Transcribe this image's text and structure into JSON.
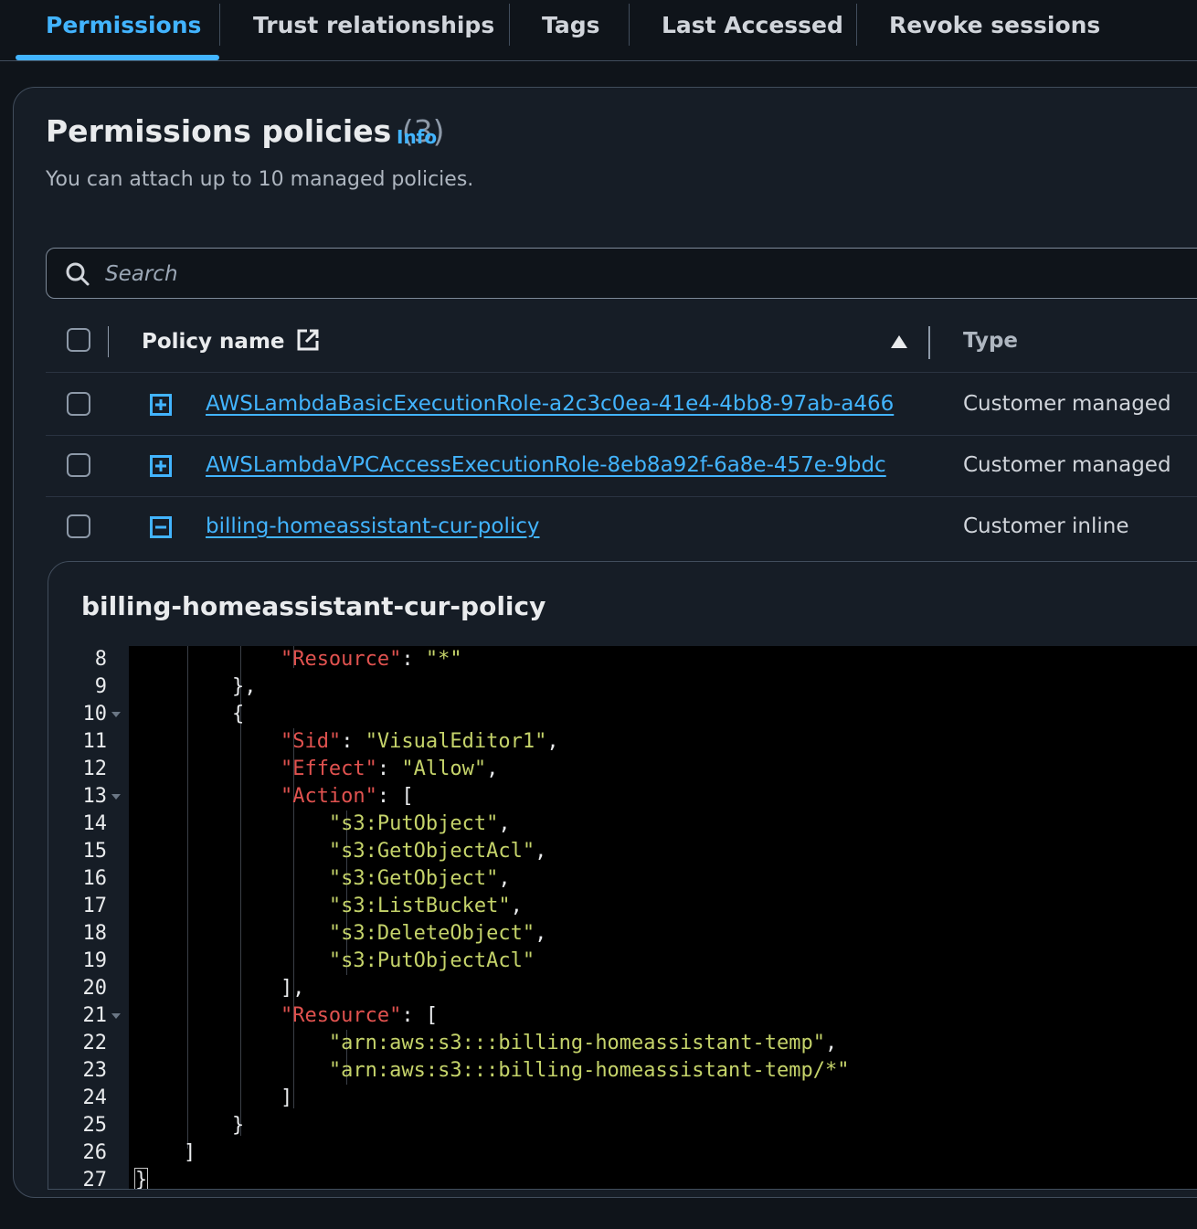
{
  "tabs": [
    {
      "label": "Permissions",
      "active": true
    },
    {
      "label": "Trust relationships",
      "active": false
    },
    {
      "label": "Tags",
      "active": false
    },
    {
      "label": "Last Accessed",
      "active": false
    },
    {
      "label": "Revoke sessions",
      "active": false
    }
  ],
  "header": {
    "title": "Permissions policies",
    "count": "(3)",
    "info": "Info",
    "description": "You can attach up to 10 managed policies."
  },
  "search": {
    "placeholder": "Search"
  },
  "table": {
    "columns": {
      "name": "Policy name",
      "type": "Type"
    },
    "sort": "ascending",
    "rows": [
      {
        "name": "AWSLambdaBasicExecutionRole-a2c3c0ea-41e4-4bb8-97ab-a466",
        "type": "Customer managed",
        "expanded": false
      },
      {
        "name": "AWSLambdaVPCAccessExecutionRole-8eb8a92f-6a8e-457e-9bdc",
        "type": "Customer managed",
        "expanded": false
      },
      {
        "name": "billing-homeassistant-cur-policy",
        "type": "Customer inline",
        "expanded": true
      }
    ]
  },
  "panel": {
    "title": "billing-homeassistant-cur-policy",
    "lines": [
      {
        "n": "8",
        "text": "            \"Resource\": \"*\""
      },
      {
        "n": "9",
        "text": "        },"
      },
      {
        "n": "10",
        "text": "        {"
      },
      {
        "n": "11",
        "text": "            \"Sid\": \"VisualEditor1\","
      },
      {
        "n": "12",
        "text": "            \"Effect\": \"Allow\","
      },
      {
        "n": "13",
        "text": "            \"Action\": ["
      },
      {
        "n": "14",
        "text": "                \"s3:PutObject\","
      },
      {
        "n": "15",
        "text": "                \"s3:GetObjectAcl\","
      },
      {
        "n": "16",
        "text": "                \"s3:GetObject\","
      },
      {
        "n": "17",
        "text": "                \"s3:ListBucket\","
      },
      {
        "n": "18",
        "text": "                \"s3:DeleteObject\","
      },
      {
        "n": "19",
        "text": "                \"s3:PutObjectAcl\""
      },
      {
        "n": "20",
        "text": "            ],"
      },
      {
        "n": "21",
        "text": "            \"Resource\": ["
      },
      {
        "n": "22",
        "text": "                \"arn:aws:s3:::billing-homeassistant-temp\","
      },
      {
        "n": "23",
        "text": "                \"arn:aws:s3:::billing-homeassistant-temp/*\""
      },
      {
        "n": "24",
        "text": "            ]"
      },
      {
        "n": "25",
        "text": "        }"
      },
      {
        "n": "26",
        "text": "    ]"
      },
      {
        "n": "27",
        "text": "}"
      }
    ]
  },
  "colors": {
    "accent": "#42b4ff",
    "background": "#0f141a",
    "json_key": "#e0524f",
    "json_string": "#c5d36a"
  },
  "icons": {
    "search": "search-icon",
    "external": "external-link-icon",
    "sort": "sort-ascending-icon",
    "expand": "expand-plus-icon",
    "collapse": "collapse-minus-icon"
  }
}
